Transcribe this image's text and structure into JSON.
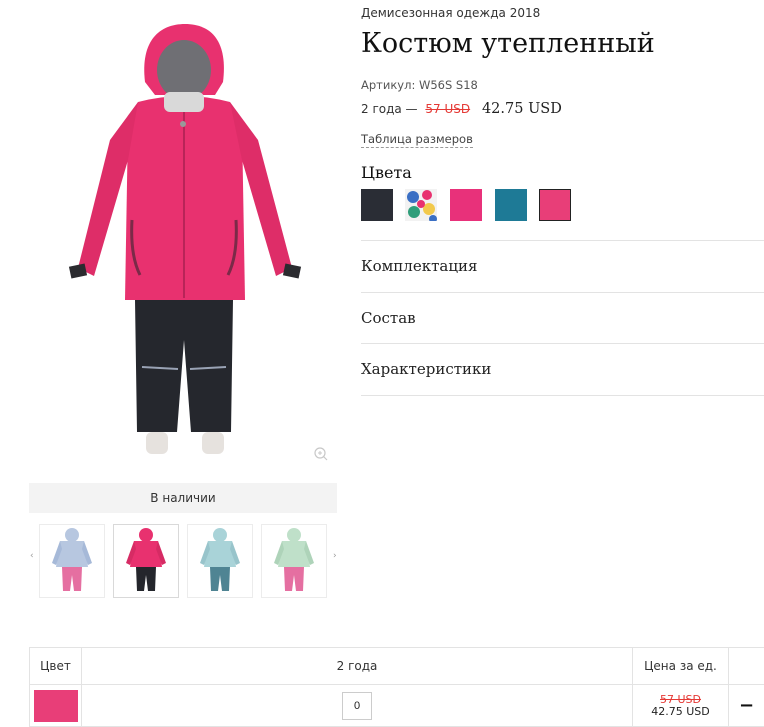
{
  "product": {
    "breadcrumb": "Демисезонная одежда 2018",
    "title": "Костюм утепленный",
    "sku": "Артикул: W56S S18",
    "price": {
      "size": "2 года —",
      "old": "57 USD",
      "new": "42.75 USD"
    },
    "size_table_link": "Таблица размеров",
    "colors_heading": "Цвета",
    "colors": [
      {
        "name": "black",
        "hex": "#2a2d35",
        "selected": false
      },
      {
        "name": "floral",
        "hex": "#3a6fc4",
        "selected": false
      },
      {
        "name": "pink",
        "hex": "#e8317a",
        "selected": false
      },
      {
        "name": "teal",
        "hex": "#1e7a96",
        "selected": false
      },
      {
        "name": "rose",
        "hex": "#e83e78",
        "selected": true
      }
    ],
    "accordion": [
      "Комплектация",
      "Состав",
      "Характеристики"
    ]
  },
  "gallery": {
    "availability": "В наличии",
    "prev_arrow": "‹",
    "next_arrow": "›",
    "thumbnails": [
      {
        "name": "floral-pink",
        "jacket": "#b7c7e0",
        "pants": "#e56fa1"
      },
      {
        "name": "pink-black",
        "jacket": "#e8316f",
        "pants": "#24262c"
      },
      {
        "name": "floral-teal",
        "jacket": "#a9d3d8",
        "pants": "#4f8493"
      },
      {
        "name": "floral-mint",
        "jacket": "#bfe0c9",
        "pants": "#e56fa1"
      }
    ]
  },
  "order_table": {
    "headers": {
      "color": "Цвет",
      "size": "2 года",
      "unit_price": "Цена за ед."
    },
    "row": {
      "swatch_hex": "#e83e78",
      "quantity": "0",
      "old_price": "57 USD",
      "new_price": "42.75 USD",
      "action": "−"
    }
  },
  "colors": {
    "accent_red": "#e53935",
    "jacket_pink": "#e8316f",
    "pants_dark": "#25272d"
  }
}
